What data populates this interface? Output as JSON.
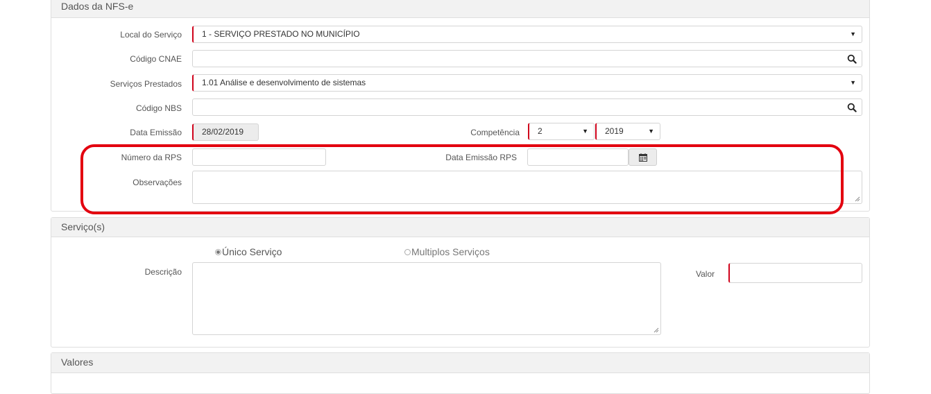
{
  "sections": {
    "nfse_title": "Dados da NFS-e",
    "servicos_title": "Serviço(s)",
    "valores_title": "Valores"
  },
  "nfse": {
    "local_label": "Local do Serviço",
    "local_value": "1 - SERVIÇO PRESTADO NO MUNICÍPIO",
    "cnae_label": "Código CNAE",
    "cnae_value": "",
    "servicos_label": "Serviços Prestados",
    "servicos_value": "1.01 Análise e desenvolvimento de sistemas",
    "nbs_label": "Código NBS",
    "nbs_value": "",
    "data_emissao_label": "Data Emissão",
    "data_emissao_value": "28/02/2019",
    "competencia_label": "Competência",
    "competencia_mes": "2",
    "competencia_ano": "2019",
    "rps_label": "Número da RPS",
    "rps_value": "",
    "data_rps_label": "Data Emissão RPS",
    "data_rps_value": "",
    "observacoes_label": "Observações"
  },
  "servico": {
    "radio_unico": "Único Serviço",
    "radio_multiplos": "Multiplos Serviços",
    "selected": "Único Serviço",
    "descricao_label": "Descrição",
    "valor_label": "Valor",
    "valor_value": ""
  },
  "icons": {
    "search": "search-icon",
    "calendar": "calendar-icon",
    "dropdown": "chevron-down-icon"
  },
  "colors": {
    "required_accent": "#d0021b",
    "highlight": "#e3000f",
    "panel_heading_bg": "#f2f2f2"
  }
}
